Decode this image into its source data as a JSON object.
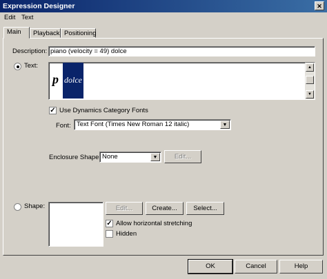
{
  "window": {
    "title": "Expression Designer"
  },
  "menu": {
    "edit": "Edit",
    "text": "Text"
  },
  "tabs": [
    {
      "label": "Main"
    },
    {
      "label": "Playback"
    },
    {
      "label": "Positioning"
    }
  ],
  "description": {
    "label": "Description:",
    "value": "piano (velocity = 49) dolce"
  },
  "text_option": {
    "label": "Text:",
    "preview_p": "p",
    "preview_dolce": "dolce"
  },
  "dynamics": {
    "checkbox_label": "Use Dynamics Category Fonts"
  },
  "font": {
    "label": "Font:",
    "value": "Text Font (Times New Roman 12  italic)"
  },
  "enclosure": {
    "label": "Enclosure Shape:",
    "value": "None",
    "edit_label": "Edit..."
  },
  "shape": {
    "label": "Shape:",
    "edit_label": "Edit...",
    "create_label": "Create...",
    "select_label": "Select...",
    "stretch_label": "Allow horizontal stretching",
    "hidden_label": "Hidden"
  },
  "buttons": {
    "ok": "OK",
    "cancel": "Cancel",
    "help": "Help"
  },
  "colors": {
    "titlebar": "#0a246a",
    "selection": "#0a246a"
  }
}
